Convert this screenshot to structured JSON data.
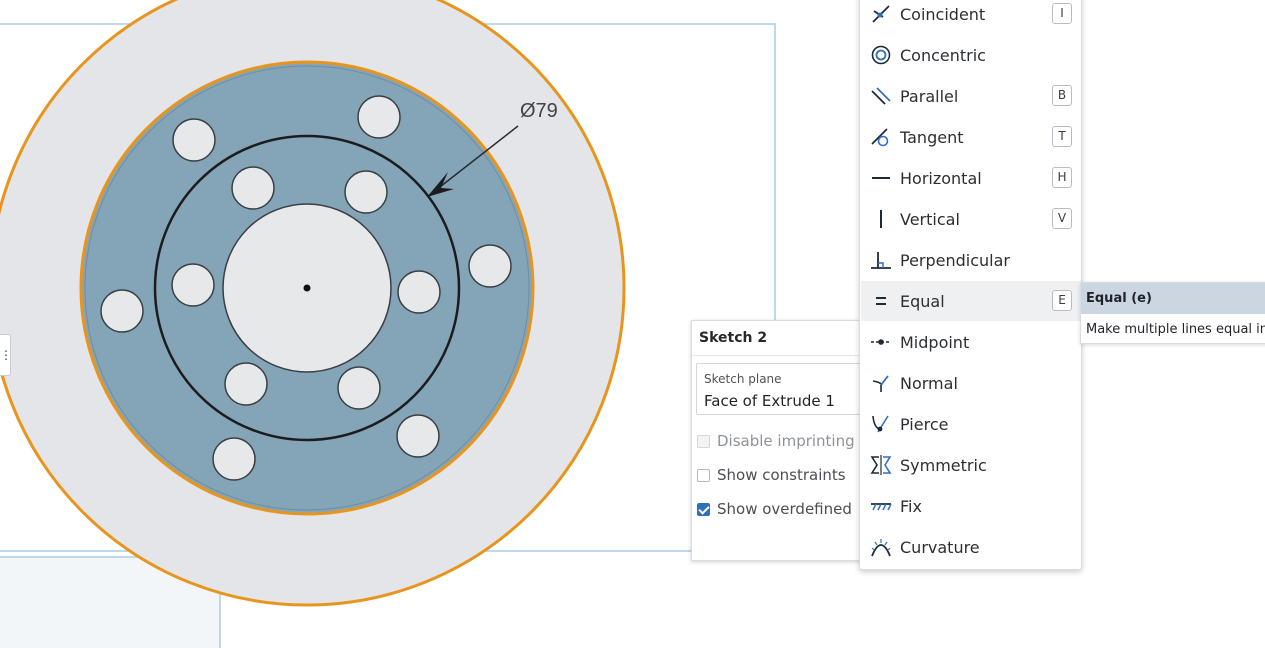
{
  "canvas": {
    "dimension_label": "Ø79",
    "colors": {
      "outer_disc": "#e3e5e8",
      "hub": "#84a4b8",
      "hole_fill": "#e6e8ea",
      "highlight": "#e8951e",
      "line": "#1c1c1c",
      "frame": "#a9cce6"
    }
  },
  "sketch_panel": {
    "title": "Sketch 2",
    "plane_label": "Sketch plane",
    "plane_value": "Face of Extrude 1",
    "options": [
      {
        "label": "Disable imprinting",
        "checked": false,
        "disabled": true
      },
      {
        "label": "Show constraints",
        "checked": false,
        "disabled": false
      },
      {
        "label": "Show overdefined",
        "checked": true,
        "disabled": false
      }
    ]
  },
  "constraint_menu": {
    "items": [
      {
        "label": "Coincident",
        "icon": "coincident-icon",
        "key": "I"
      },
      {
        "label": "Concentric",
        "icon": "concentric-icon",
        "key": ""
      },
      {
        "label": "Parallel",
        "icon": "parallel-icon",
        "key": "B"
      },
      {
        "label": "Tangent",
        "icon": "tangent-icon",
        "key": "T"
      },
      {
        "label": "Horizontal",
        "icon": "horizontal-icon",
        "key": "H"
      },
      {
        "label": "Vertical",
        "icon": "vertical-icon",
        "key": "V"
      },
      {
        "label": "Perpendicular",
        "icon": "perpendicular-icon",
        "key": ""
      },
      {
        "label": "Equal",
        "icon": "equal-icon",
        "key": "E",
        "active": true
      },
      {
        "label": "Midpoint",
        "icon": "midpoint-icon",
        "key": ""
      },
      {
        "label": "Normal",
        "icon": "normal-icon",
        "key": ""
      },
      {
        "label": "Pierce",
        "icon": "pierce-icon",
        "key": ""
      },
      {
        "label": "Symmetric",
        "icon": "symmetric-icon",
        "key": ""
      },
      {
        "label": "Fix",
        "icon": "fix-icon",
        "key": ""
      },
      {
        "label": "Curvature",
        "icon": "curvature-icon",
        "key": ""
      }
    ]
  },
  "tooltip": {
    "title": "Equal (e)",
    "description": "Make multiple lines equal in"
  }
}
